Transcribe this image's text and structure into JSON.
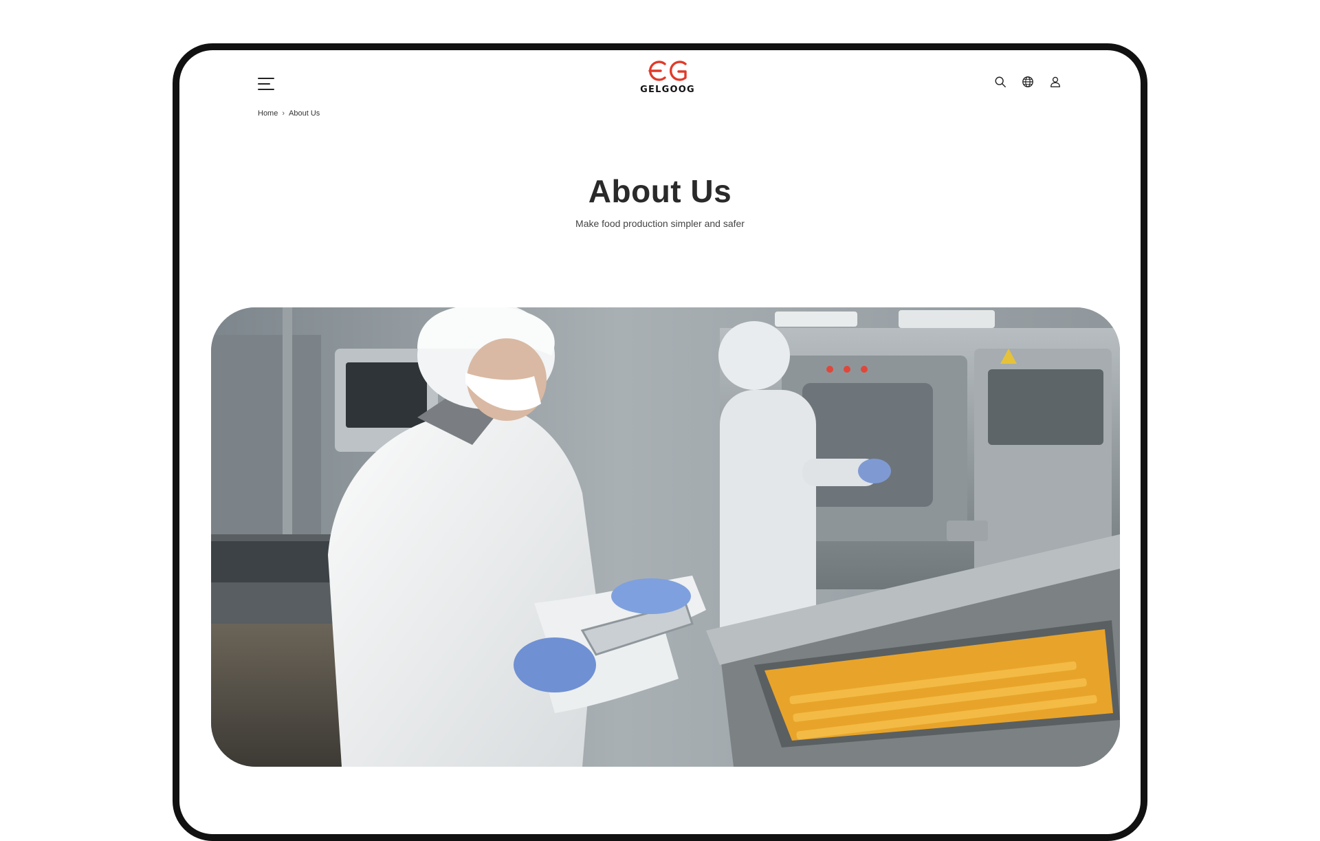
{
  "header": {
    "menu_icon": "hamburger-menu-icon",
    "logo": {
      "text": "GELGOOG",
      "brand_color": "#e23a2a"
    },
    "icons": [
      "search-icon",
      "globe-icon",
      "user-icon"
    ]
  },
  "breadcrumb": {
    "items": [
      {
        "label": "Home"
      },
      {
        "label": "About Us"
      }
    ],
    "separator_icon": "chevron-right-icon"
  },
  "hero": {
    "title": "About Us",
    "subtitle": "Make food production simpler and safer"
  },
  "photo": {
    "kind": "food-factory-worker-photo"
  },
  "colors": {
    "frame": "#111111",
    "text_primary": "#2a2a2a",
    "brand_red": "#e23a2a"
  }
}
